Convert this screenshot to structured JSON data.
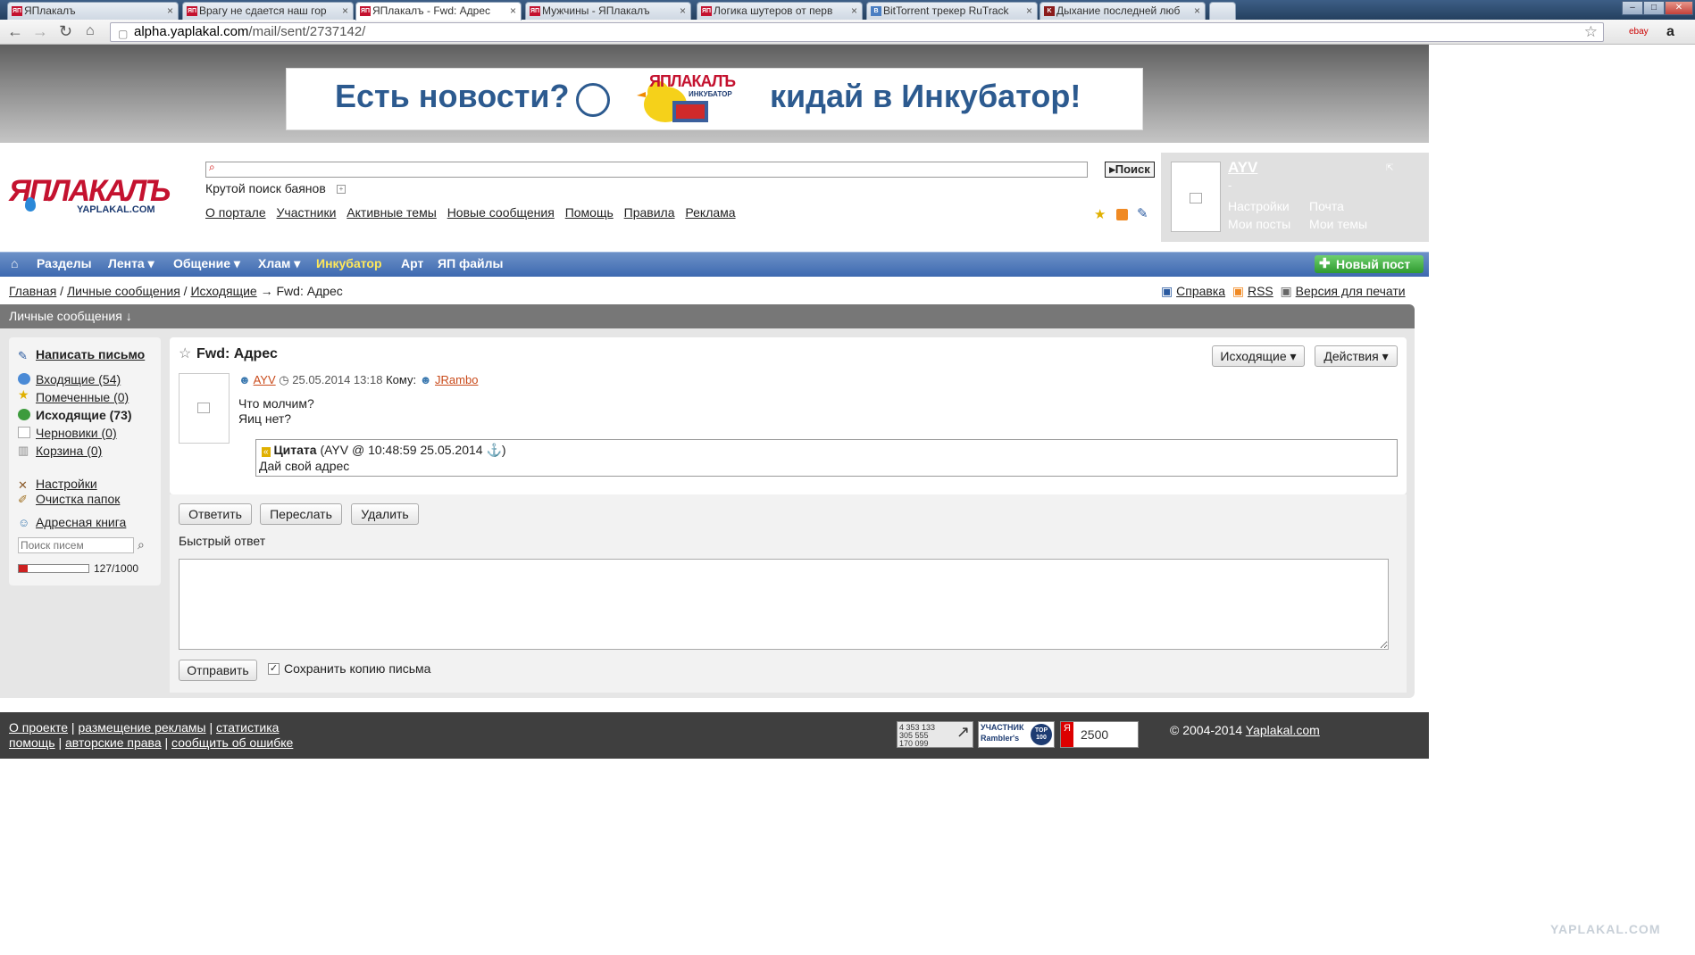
{
  "browser": {
    "tabs": [
      {
        "title": "ЯПлакалъ",
        "active": false
      },
      {
        "title": "Врагу не сдается наш гор",
        "active": false
      },
      {
        "title": "ЯПлакалъ - Fwd: Адрес",
        "active": true
      },
      {
        "title": "Мужчины - ЯПлакалъ",
        "active": false
      },
      {
        "title": "Логика шутеров от перв",
        "active": false
      },
      {
        "title": "BitTorrent трекер RuTrack",
        "active": false
      },
      {
        "title": "Дыхание последней люб",
        "active": false
      }
    ],
    "url_host": "alpha.yaplakal.com",
    "url_path": "/mail/sent/2737142/"
  },
  "banner": {
    "left_text": "Есть новости?",
    "right_text": "кидай в Инкубатор!",
    "logo_text": "ЯПЛАКАЛЪ",
    "logo_sub": "ИНКУБАТОР"
  },
  "header": {
    "logo_text": "ЯПЛАКАЛЪ",
    "logo_sub": "YAPLAKAL.COM",
    "search_button": "Поиск",
    "search_hint": "Крутой поиск баянов",
    "links": [
      "О портале",
      "Участники",
      "Активные темы",
      "Новые сообщения",
      "Помощь",
      "Правила",
      "Реклама"
    ]
  },
  "user": {
    "name": "AYV",
    "status": "-",
    "links": [
      "Настройки",
      "Почта",
      "Мои посты",
      "Мои темы"
    ]
  },
  "nav": {
    "items": [
      "Разделы",
      "Лента",
      "Общение",
      "Хлам",
      "Инкубатор",
      "Арт",
      "ЯП файлы"
    ],
    "new_post": "Новый пост"
  },
  "breadcrumb": {
    "items": [
      "Главная",
      "Личные сообщения",
      "Исходящие"
    ],
    "current": "Fwd: Адрес",
    "right": [
      "Справка",
      "RSS",
      "Версия для печати"
    ]
  },
  "section_title": "Личные сообщения ↓",
  "sidebar": {
    "compose": "Написать письмо",
    "folders": [
      {
        "label": "Входящие (54)",
        "current": false
      },
      {
        "label": "Помеченные (0)",
        "current": false
      },
      {
        "label": "Исходящие (73)",
        "current": true
      },
      {
        "label": "Черновики (0)",
        "current": false
      },
      {
        "label": "Корзина (0)",
        "current": false
      }
    ],
    "settings": "Настройки",
    "clean": "Очистка папок",
    "addressbook": "Адресная книга",
    "search_placeholder": "Поиск писем",
    "quota_text": "127/1000",
    "quota_fraction": 0.127
  },
  "message": {
    "title": "Fwd: Адрес",
    "folder_button": "Исходящие",
    "actions_button": "Действия",
    "from": "AYV",
    "date": "25.05.2014 13:18",
    "to_label": "Кому:",
    "to": "JRambo",
    "body_line1": "Что молчим?",
    "body_line2": "Яиц нет?",
    "quote_label": "Цитата",
    "quote_meta": "(AYV @ 10:48:59 25.05.2014",
    "quote_text": "Дай свой адрес"
  },
  "actions": {
    "reply": "Ответить",
    "forward": "Переслать",
    "delete": "Удалить",
    "quick_reply": "Быстрый ответ",
    "send": "Отправить",
    "save_copy": "Сохранить копию письма"
  },
  "footer": {
    "line1": [
      "О проекте",
      "размещение рекламы",
      "статистика"
    ],
    "line2": [
      "помощь",
      "авторские права",
      "сообщить об ошибке"
    ],
    "counter1": [
      "4 353 133",
      "305 555",
      "170 099"
    ],
    "counter2_top": "УЧАСТНИК",
    "counter2_bottom": "Rambler's",
    "counter2_badge": "TOP 100",
    "counter3": "2500",
    "counter3_y": "Я",
    "copyright": "© 2004-2014",
    "copyright_link": "Yaplakal.com"
  },
  "watermark": "YAPLAKAL.COM"
}
